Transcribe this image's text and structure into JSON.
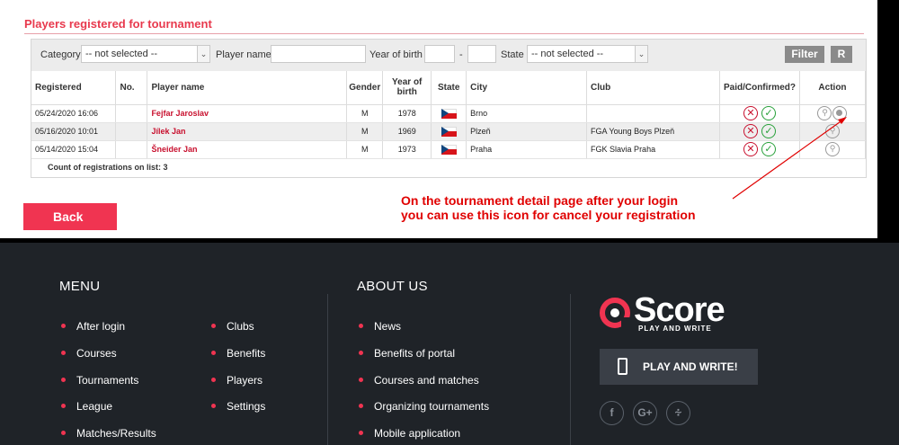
{
  "section_title": "Players registered for tournament",
  "filter": {
    "category_label": "Category",
    "category_value": "-- not selected --",
    "player_name_label": "Player name",
    "player_name_value": "",
    "year_of_birth_label": "Year of birth",
    "year_from": "",
    "year_separator": "-",
    "year_to": "",
    "state_label": "State",
    "state_value": "-- not selected --",
    "filter_button": "Filter",
    "reset_button": "R"
  },
  "table": {
    "headers": {
      "registered": "Registered",
      "no": "No.",
      "player_name": "Player name",
      "gender": "Gender",
      "year_of_birth_1": "Year of",
      "year_of_birth_2": "birth",
      "state": "State",
      "city": "City",
      "club": "Club",
      "paid": "Paid/Confirmed?",
      "action": "Action"
    },
    "rows": [
      {
        "registered": "05/24/2020 16:06",
        "no": "",
        "player": "Fejfar Jaroslav",
        "gender": "M",
        "year": "1978",
        "state": "czech-flag",
        "city": "Brno",
        "club": "",
        "paid": "no",
        "confirmed": "yes"
      },
      {
        "registered": "05/16/2020 10:01",
        "no": "",
        "player": "Jílek Jan",
        "gender": "M",
        "year": "1969",
        "state": "czech-flag",
        "city": "Plzeň",
        "club": "FGA Young Boys Plzeň",
        "paid": "no",
        "confirmed": "yes"
      },
      {
        "registered": "05/14/2020 15:04",
        "no": "",
        "player": "Šneider Jan",
        "gender": "M",
        "year": "1973",
        "state": "czech-flag",
        "city": "Praha",
        "club": "FGK Slavia Praha",
        "paid": "no",
        "confirmed": "yes"
      }
    ],
    "count_text": "Count of registrations on list: 3"
  },
  "annotation": {
    "line1": "On the tournament detail page after your login",
    "line2": "you can use this icon for cancel your registration",
    "color": "#e00000"
  },
  "back_button": "Back",
  "colors": {
    "accent": "#f03451",
    "title": "#e8394d",
    "footer_bg": "#1f2328"
  },
  "footer": {
    "menu_title": "MENU",
    "menu_col1": [
      "After login",
      "Courses",
      "Tournaments",
      "League",
      "Matches/Results"
    ],
    "menu_col2": [
      "Clubs",
      "Benefits",
      "Players",
      "Settings"
    ],
    "about_title": "ABOUT US",
    "about_items": [
      "News",
      "Benefits of portal",
      "Courses and matches",
      "Organizing tournaments",
      "Mobile application"
    ],
    "logo_text": "Score",
    "logo_tagline": "PLAY AND WRITE",
    "play_button": "PLAY AND WRITE!",
    "social": [
      "facebook-icon",
      "google-plus-icon",
      "rss-icon"
    ]
  }
}
